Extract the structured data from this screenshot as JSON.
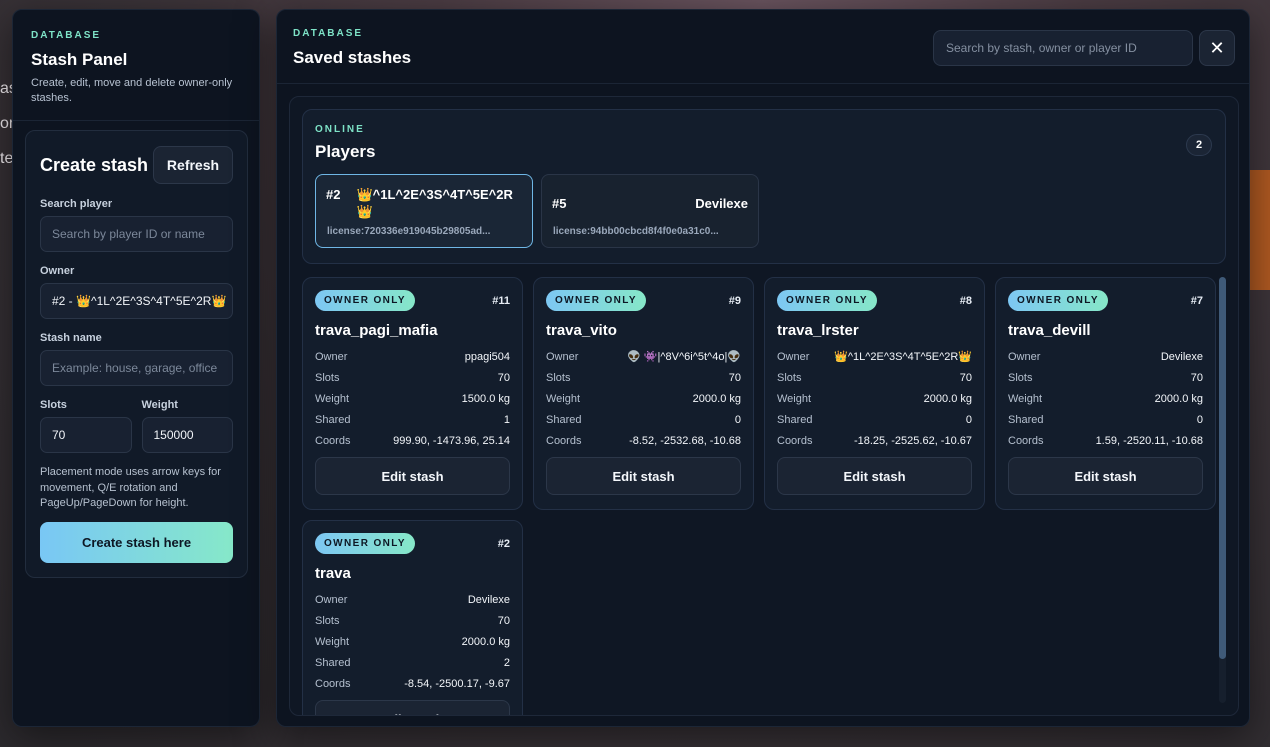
{
  "background": {
    "fragments": [
      "as",
      "or",
      "te"
    ]
  },
  "left_panel": {
    "eyebrow": "DATABASE",
    "title": "Stash Panel",
    "subtitle": "Create, edit, move and delete owner-only stashes.",
    "create": {
      "title": "Create stash",
      "refresh_label": "Refresh",
      "search_label": "Search player",
      "search_placeholder": "Search by player ID or name",
      "owner_label": "Owner",
      "owner_value": "#2 - 👑^1L^2E^3S^4T^5E^2R👑",
      "stash_name_label": "Stash name",
      "stash_name_placeholder": "Example: house, garage, office",
      "slots_label": "Slots",
      "slots_value": "70",
      "weight_label": "Weight",
      "weight_value": "150000",
      "help_text": "Placement mode uses arrow keys for movement, Q/E rotation and PageUp/PageDown for height.",
      "submit_label": "Create stash here"
    }
  },
  "main_panel": {
    "eyebrow": "DATABASE",
    "title": "Saved stashes",
    "search_placeholder": "Search by stash, owner or player ID",
    "close_icon": "✕",
    "players": {
      "eyebrow": "ONLINE",
      "title": "Players",
      "count": "2",
      "items": [
        {
          "id": "#2",
          "name": "👑^1L^2E^3S^4T^5E^2R👑",
          "license": "license:720336e919045b29805ad..."
        },
        {
          "id": "#5",
          "name": "Devilexe",
          "license": "license:94bb00cbcd8f4f0e0a31c0..."
        }
      ]
    },
    "labels": {
      "owner": "Owner",
      "slots": "Slots",
      "weight": "Weight",
      "shared": "Shared",
      "coords": "Coords",
      "edit": "Edit stash"
    },
    "stashes": [
      {
        "badge": "OWNER ONLY",
        "num": "#11",
        "name": "trava_pagi_mafia",
        "owner": "ppagi504",
        "slots": "70",
        "weight": "1500.0 kg",
        "shared": "1",
        "coords": "999.90, -1473.96, 25.14"
      },
      {
        "badge": "OWNER ONLY",
        "num": "#9",
        "name": "trava_vito",
        "owner": "👽 👾|^8V^6i^5t^4o|👽",
        "slots": "70",
        "weight": "2000.0 kg",
        "shared": "0",
        "coords": "-8.52, -2532.68, -10.68"
      },
      {
        "badge": "OWNER ONLY",
        "num": "#8",
        "name": "trava_lrster",
        "owner": "👑^1L^2E^3S^4T^5E^2R👑",
        "slots": "70",
        "weight": "2000.0 kg",
        "shared": "0",
        "coords": "-18.25, -2525.62, -10.67"
      },
      {
        "badge": "OWNER ONLY",
        "num": "#7",
        "name": "trava_devill",
        "owner": "Devilexe",
        "slots": "70",
        "weight": "2000.0 kg",
        "shared": "0",
        "coords": "1.59, -2520.11, -10.68"
      },
      {
        "badge": "OWNER ONLY",
        "num": "#2",
        "name": "trava",
        "owner": "Devilexe",
        "slots": "70",
        "weight": "2000.0 kg",
        "shared": "2",
        "coords": "-8.54, -2500.17, -9.67"
      }
    ]
  }
}
